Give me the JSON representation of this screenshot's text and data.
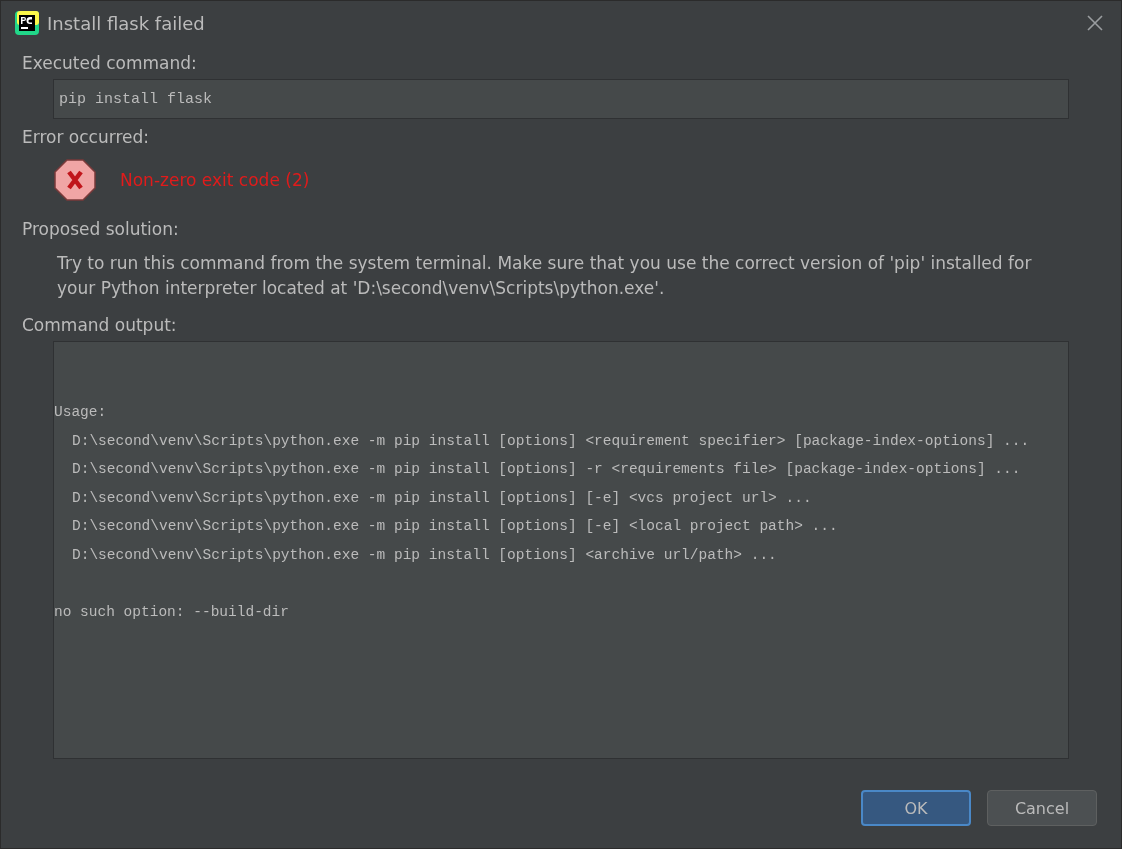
{
  "window": {
    "title": "Install flask failed"
  },
  "executed": {
    "label": "Executed command:",
    "command": "pip install flask"
  },
  "error": {
    "label": "Error occurred:",
    "message": "Non-zero exit code (2)"
  },
  "solution": {
    "label": "Proposed solution:",
    "text": "Try to run this command from the system terminal. Make sure that you use the correct version of 'pip' installed for your Python interpreter located at 'D:\\second\\venv\\Scripts\\python.exe'."
  },
  "output": {
    "label": "Command output:",
    "heading": "Usage:",
    "usage_lines": [
      "D:\\second\\venv\\Scripts\\python.exe -m pip install [options] <requirement specifier> [package-index-options] ...",
      "D:\\second\\venv\\Scripts\\python.exe -m pip install [options] -r <requirements file> [package-index-options] ...",
      "D:\\second\\venv\\Scripts\\python.exe -m pip install [options] [-e] <vcs project url> ...",
      "D:\\second\\venv\\Scripts\\python.exe -m pip install [options] [-e] <local project path> ...",
      "D:\\second\\venv\\Scripts\\python.exe -m pip install [options] <archive url/path> ..."
    ],
    "message": "no such option: --build-dir"
  },
  "buttons": [
    {
      "label": "OK",
      "default": true
    },
    {
      "label": "Cancel",
      "default": false
    }
  ]
}
